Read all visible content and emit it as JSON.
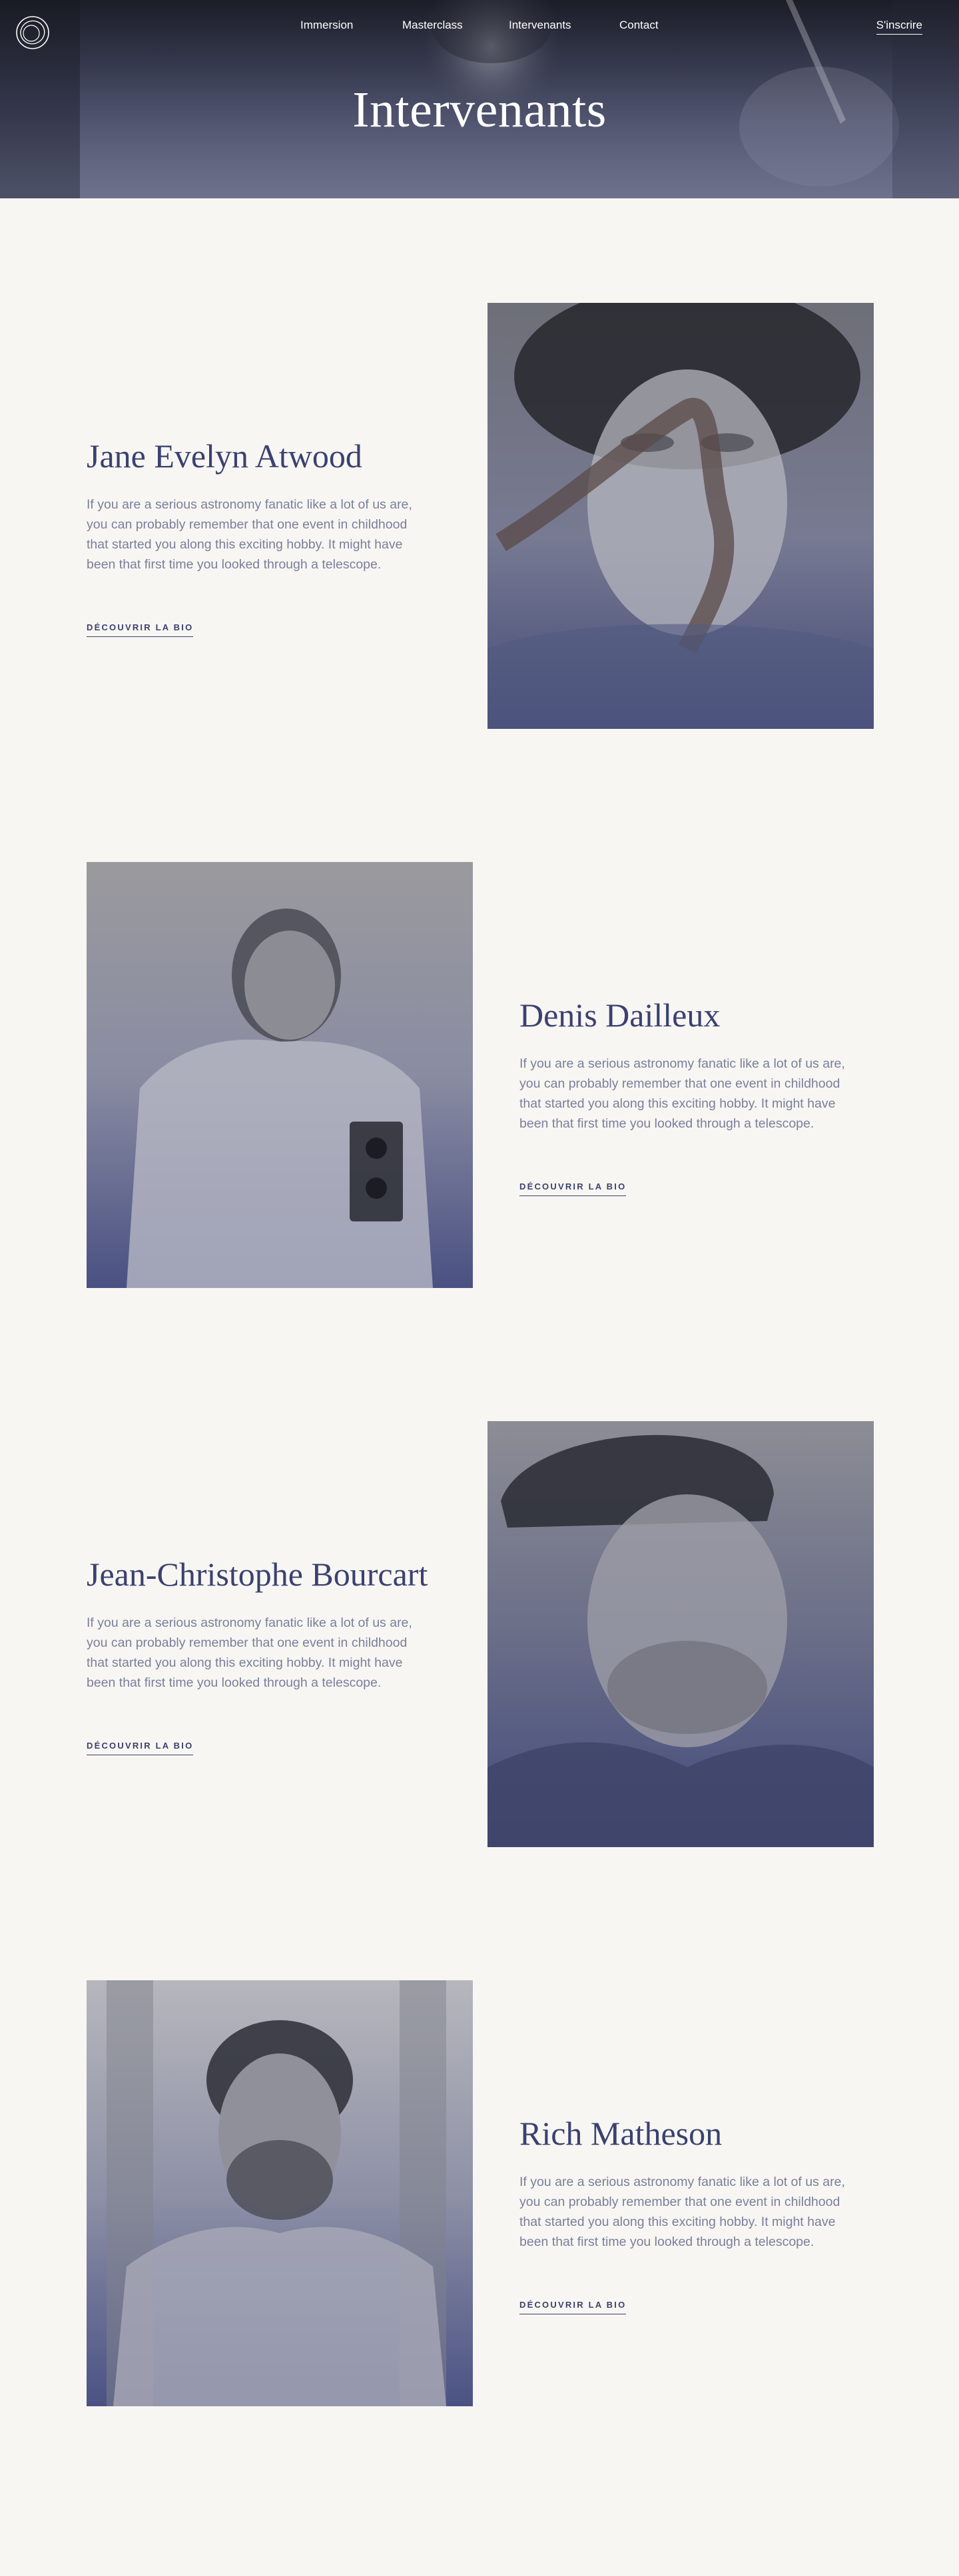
{
  "header": {
    "nav": [
      {
        "label": "Immersion"
      },
      {
        "label": "Masterclass"
      },
      {
        "label": "Intervenants"
      },
      {
        "label": "Contact"
      }
    ],
    "signup_label": "S'inscrire",
    "title": "Intervenants"
  },
  "speakers": [
    {
      "name": "Jane Evelyn Atwood",
      "bio": "If you are a serious astronomy fanatic like a lot of us are, you can probably remember that one event in childhood that started you along this exciting hobby. It might have been that first time you looked through a telescope.",
      "cta": "DÉCOUVRIR LA BIO"
    },
    {
      "name": "Denis Dailleux",
      "bio": "If you are a serious astronomy fanatic like a lot of us are, you can probably remember that one event in childhood that started you along this exciting hobby. It might have been that first time you looked through a telescope.",
      "cta": "DÉCOUVRIR LA BIO"
    },
    {
      "name": "Jean-Christophe Bourcart",
      "bio": "If you are a serious astronomy fanatic like a lot of us are, you can probably remember that one event in childhood that started you along this exciting hobby. It might have been that first time you looked through a telescope.",
      "cta": "DÉCOUVRIR LA BIO"
    },
    {
      "name": "Rich Matheson",
      "bio": "If you are a serious astronomy fanatic like a lot of us are, you can probably remember that one event in childhood that started you along this exciting hobby. It might have been that first time you looked through a telescope.",
      "cta": "DÉCOUVRIR LA BIO"
    }
  ],
  "colors": {
    "background": "#f7f6f2",
    "accent": "#3b4170",
    "body_text": "#7a7f9c"
  },
  "icons": [
    "logo-rings-icon"
  ]
}
